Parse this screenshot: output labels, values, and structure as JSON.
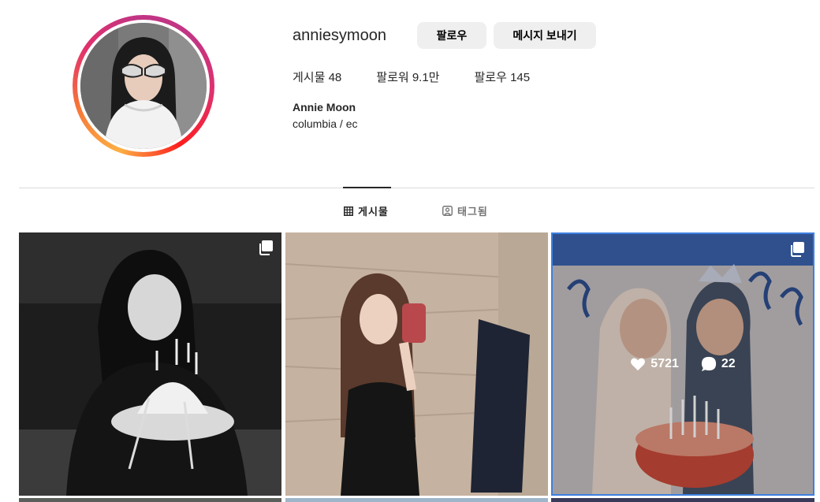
{
  "profile": {
    "username": "anniesymoon",
    "follow_label": "팔로우",
    "message_label": "메시지 보내기",
    "stats": {
      "posts": "게시물 48",
      "followers": "팔로워 9.1만",
      "following": "팔로우 145"
    },
    "full_name": "Annie Moon",
    "bio": "columbia / ec"
  },
  "tabs": {
    "posts": "게시물",
    "tagged": "태그됨"
  },
  "grid": {
    "hover_post": {
      "likes": "5721",
      "comments": "22"
    }
  },
  "colors": {
    "accent_border": "#3d7fe0",
    "button_bg": "#efefef"
  },
  "icons": {
    "multi": "multiple-images-icon",
    "heart": "heart-icon",
    "comment": "comment-icon",
    "grid": "grid-icon",
    "tagged": "tagged-icon"
  }
}
